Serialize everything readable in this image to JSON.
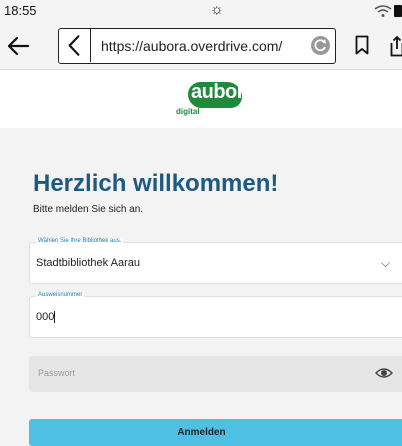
{
  "status_bar": {
    "time": "18:55",
    "brightness_icon": "brightness-icon",
    "wifi_icon": "wifi-icon",
    "battery_icon": "battery-icon"
  },
  "browser": {
    "url": "https://aubora.overdrive.com/",
    "back_icon": "arrow-left-icon",
    "page_back_icon": "chevron-left-icon",
    "reload_icon": "reload-icon",
    "bookmark_icon": "bookmark-icon",
    "share_icon": "share-icon"
  },
  "logo": {
    "text": "aubora",
    "sub": "digital",
    "color": "#1f8a3a"
  },
  "login": {
    "title": "Herzlich willkommen!",
    "subtitle": "Bitte melden Sie sich an.",
    "library_label": "Wählen Sie Ihre Bibliothek aus.",
    "library_value": "Stadtbibliothek Aarau",
    "card_label": "Ausweisnummer",
    "card_value": "000",
    "password_placeholder": "Passwort",
    "submit_label": "Anmelden",
    "title_color": "#1d5a80",
    "button_color": "#4ec0e4"
  }
}
